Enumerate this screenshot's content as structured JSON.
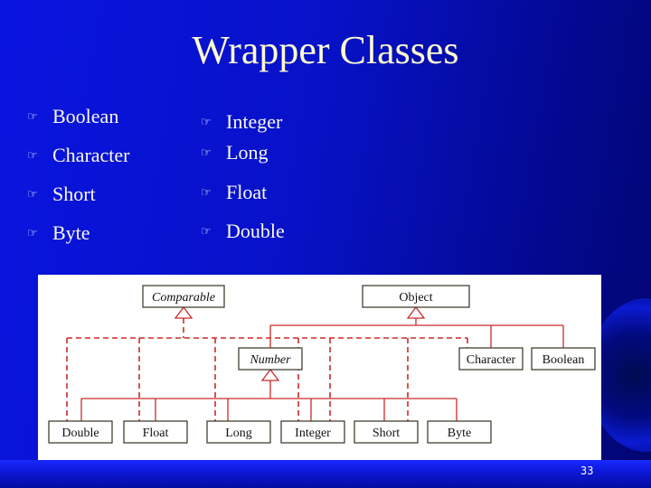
{
  "slide": {
    "title": "Wrapper Classes",
    "page_number": "33",
    "bullet_icon": "pointing-hand-icon",
    "left_column": [
      "Boolean",
      "Character",
      "Short",
      "Byte"
    ],
    "right_column": [
      "Integer",
      "Long",
      "Float",
      "Double"
    ]
  },
  "diagram": {
    "colors": {
      "line": "#cc2a2a",
      "box_border": "#333322",
      "box_fill": "#ffffff",
      "text": "#111111"
    },
    "nodes": {
      "comparable": {
        "label": "Comparable",
        "italic": true
      },
      "object": {
        "label": "Object",
        "italic": false
      },
      "number": {
        "label": "Number",
        "italic": true
      },
      "character": {
        "label": "Character",
        "italic": false
      },
      "boolean": {
        "label": "Boolean",
        "italic": false
      },
      "double": {
        "label": "Double",
        "italic": false
      },
      "float": {
        "label": "Float",
        "italic": false
      },
      "long": {
        "label": "Long",
        "italic": false
      },
      "integer": {
        "label": "Integer",
        "italic": false
      },
      "short": {
        "label": "Short",
        "italic": false
      },
      "byte": {
        "label": "Byte",
        "italic": false
      }
    },
    "edges": [
      {
        "from": "number",
        "to": "object",
        "type": "extends"
      },
      {
        "from": "character",
        "to": "object",
        "type": "extends"
      },
      {
        "from": "boolean",
        "to": "object",
        "type": "extends"
      },
      {
        "from": "double",
        "to": "number",
        "type": "extends"
      },
      {
        "from": "float",
        "to": "number",
        "type": "extends"
      },
      {
        "from": "long",
        "to": "number",
        "type": "extends"
      },
      {
        "from": "integer",
        "to": "number",
        "type": "extends"
      },
      {
        "from": "short",
        "to": "number",
        "type": "extends"
      },
      {
        "from": "byte",
        "to": "number",
        "type": "extends"
      },
      {
        "from": "double",
        "to": "comparable",
        "type": "implements"
      },
      {
        "from": "float",
        "to": "comparable",
        "type": "implements"
      },
      {
        "from": "long",
        "to": "comparable",
        "type": "implements"
      },
      {
        "from": "integer",
        "to": "comparable",
        "type": "implements"
      },
      {
        "from": "short",
        "to": "comparable",
        "type": "implements"
      },
      {
        "from": "byte",
        "to": "comparable",
        "type": "implements"
      },
      {
        "from": "character",
        "to": "comparable",
        "type": "implements"
      }
    ]
  }
}
